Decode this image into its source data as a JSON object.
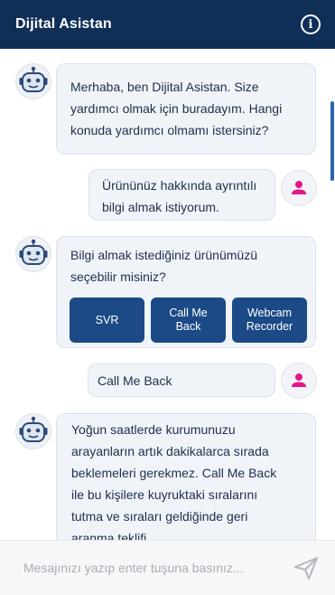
{
  "header": {
    "title": "Dijital Asistan",
    "info_icon": "info-icon"
  },
  "messages": [
    {
      "sender": "bot",
      "text": "Merhaba, ben Dijital Asistan. Size yardımcı olmak için buradayım. Hangi konuda yardımcı olmamı istersiniz?"
    },
    {
      "sender": "user",
      "text": "Ürününüz hakkında ayrıntılı bilgi almak istiyorum."
    },
    {
      "sender": "bot",
      "text": "Bilgi almak istediğiniz ürünümüzü seçebilir misiniz?",
      "buttons": [
        "SVR",
        "Call Me Back",
        "Webcam Recorder"
      ]
    },
    {
      "sender": "user",
      "text": "Call Me Back"
    },
    {
      "sender": "bot",
      "text": "Yoğun saatlerde kurumunuzu arayanların artık dakikalarca sırada beklemeleri gerekmez. Call Me Back ile bu kişilere kuyruktaki sıralarını tutma ve sıraları geldiğinde geri aranma teklifi"
    }
  ],
  "input": {
    "placeholder": "Mesajınızı yazıp enter tuşuna basınız..."
  },
  "icons": {
    "bot_avatar": "robot-icon",
    "user_avatar": "user-icon",
    "send": "send-icon"
  },
  "colors": {
    "header_bg": "#0f2f57",
    "button_bg": "#1b4a87",
    "user_icon": "#e0198a",
    "bubble_bg": "#f0f4f9"
  }
}
